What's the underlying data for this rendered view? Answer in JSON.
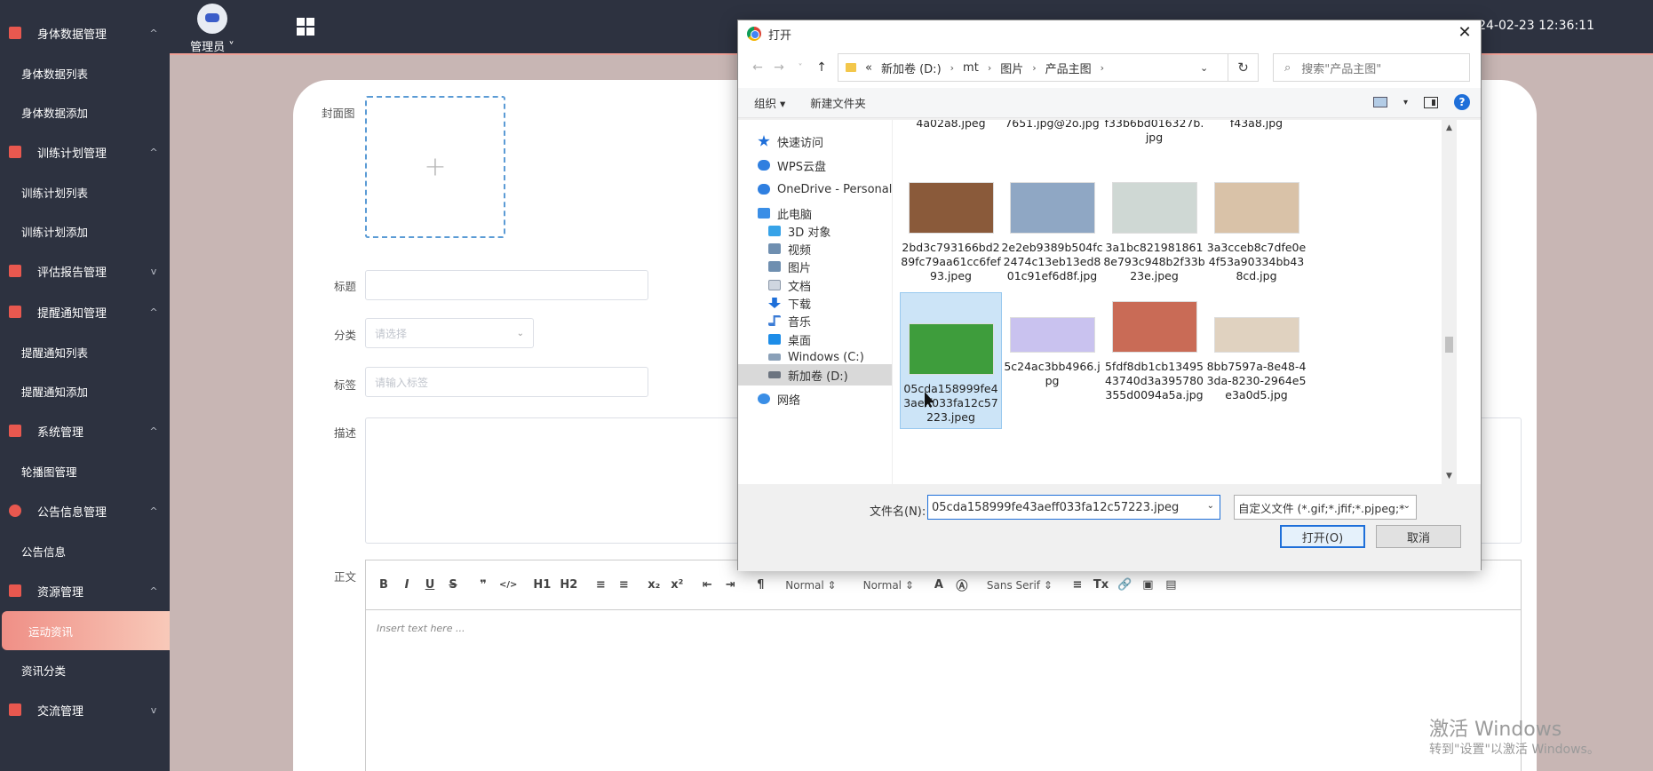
{
  "sidebar": {
    "groups": [
      {
        "label": "身体数据管理",
        "chevron": "^",
        "icon": "chart-icon",
        "items": [
          "身体数据列表",
          "身体数据添加"
        ]
      },
      {
        "label": "训练计划管理",
        "chevron": "^",
        "icon": "chart-icon",
        "items": [
          "训练计划列表",
          "训练计划添加"
        ]
      },
      {
        "label": "评估报告管理",
        "chevron": "v",
        "icon": "chart-icon",
        "items": []
      },
      {
        "label": "提醒通知管理",
        "chevron": "^",
        "icon": "chart-icon",
        "items": [
          "提醒通知列表",
          "提醒通知添加"
        ]
      },
      {
        "label": "系统管理",
        "chevron": "^",
        "icon": "bar-chart-icon",
        "items": [
          "轮播图管理"
        ]
      },
      {
        "label": "公告信息管理",
        "chevron": "^",
        "icon": "info-icon",
        "items": [
          "公告信息"
        ]
      },
      {
        "label": "资源管理",
        "chevron": "^",
        "icon": "flag-icon",
        "items": [
          "运动资讯",
          "资讯分类"
        ],
        "active_item": "运动资讯"
      },
      {
        "label": "交流管理",
        "chevron": "v",
        "icon": "send-icon",
        "items": []
      }
    ]
  },
  "topbar": {
    "user_label": "管理员 ˅",
    "clock": "24-02-23 12:36:11"
  },
  "form": {
    "cover_label": "封面图",
    "title_label": "标题",
    "category_label": "分类",
    "category_placeholder": "请选择",
    "tags_label": "标签",
    "tags_placeholder": "请输入标签",
    "desc_label": "描述",
    "body_label": "正文",
    "editor_placeholder": "Insert text here ...",
    "toolbar": {
      "bold": "B",
      "italic": "I",
      "underline": "U",
      "strike": "S",
      "quote": "❞",
      "code": "</>",
      "h1": "H1",
      "h2": "H2",
      "ol": "≡",
      "ul": "≡",
      "sub": "x₂",
      "sup": "x²",
      "outdent": "⇤",
      "indent": "⇥",
      "rtl": "¶",
      "size": "Normal ⇕",
      "header": "Normal ⇕",
      "font": "Sans Serif ⇕",
      "align": "≡",
      "clean": "Tx",
      "link": "🔗",
      "image": "▣",
      "video": "▤"
    }
  },
  "dialog": {
    "title": "打开",
    "close": "✕",
    "nav": {
      "back": "←",
      "forward": "→",
      "recent": "˅",
      "up": "↑"
    },
    "breadcrumb": [
      "«",
      "新加卷 (D:)",
      "mt",
      "图片",
      "产品主图"
    ],
    "refresh": "↻",
    "search_placeholder": "搜索\"产品主图\"",
    "organize": "组织 ▾",
    "new_folder": "新建文件夹",
    "help": "?",
    "nav_pane": [
      {
        "label": "快速访问",
        "icon": "star-icon",
        "sub": false
      },
      {
        "label": "WPS云盘",
        "icon": "cloud-icon",
        "sub": false
      },
      {
        "label": "OneDrive - Personal",
        "icon": "onedrive-icon",
        "sub": false
      },
      {
        "label": "此电脑",
        "icon": "computer-icon",
        "sub": false
      },
      {
        "label": "3D 对象",
        "icon": "cube-icon",
        "sub": true
      },
      {
        "label": "视频",
        "icon": "video-icon",
        "sub": true
      },
      {
        "label": "图片",
        "icon": "image-icon",
        "sub": true
      },
      {
        "label": "文档",
        "icon": "document-icon",
        "sub": true
      },
      {
        "label": "下载",
        "icon": "download-icon",
        "sub": true
      },
      {
        "label": "音乐",
        "icon": "music-icon",
        "sub": true
      },
      {
        "label": "桌面",
        "icon": "desktop-icon",
        "sub": true
      },
      {
        "label": "Windows (C:)",
        "icon": "drive-icon",
        "sub": true
      },
      {
        "label": "新加卷 (D:)",
        "icon": "drive-icon",
        "sub": true,
        "selected": true
      },
      {
        "label": "网络",
        "icon": "network-icon",
        "sub": false
      }
    ],
    "files": [
      {
        "name": "4a02a8.jpeg",
        "color": "",
        "thumb": false
      },
      {
        "name": "7651.jpg@2o.jpg",
        "color": "",
        "thumb": false
      },
      {
        "name": "f33b6bd016327b.jpg",
        "color": "",
        "thumb": false
      },
      {
        "name": "f43a8.jpg",
        "color": "",
        "thumb": false
      },
      {
        "name": "2bd3c793166bd289fc79aa61cc6fef93.jpeg",
        "color": "#8a5a3a",
        "thumb": true
      },
      {
        "name": "2e2eb9389b504fc2474c13eb13ed801c91ef6d8f.jpg",
        "color": "#8fa7c4",
        "thumb": true
      },
      {
        "name": "3a1bc8219818618e793c948b2f33b23e.jpeg",
        "color": "#cfd8d4",
        "thumb": true
      },
      {
        "name": "3a3cceb8c7dfe0e4f53a90334bb438cd.jpg",
        "color": "#d9c2a8",
        "thumb": true
      },
      {
        "name": "05cda158999fe43aeff033fa12c57223.jpeg",
        "color": "#3e9d3c",
        "thumb": true,
        "selected": true
      },
      {
        "name": "5c24ac3bb4966.jpg",
        "color": "#c9c2ef",
        "thumb": true
      },
      {
        "name": "5fdf8db1cb1349543740d3a395780355d0094a5a.jpg",
        "color": "#c96b56",
        "thumb": true
      },
      {
        "name": "8bb7597a-8e48-43da-8230-2964e5e3a0d5.jpg",
        "color": "#e0d2c0",
        "thumb": true
      }
    ],
    "filename_label": "文件名(N):",
    "filename_value": "05cda158999fe43aeff033fa12c57223.jpeg",
    "filetype": "自定义文件 (*.gif;*.jfif;*.pjpeg;*",
    "open_button": "打开(O)",
    "cancel_button": "取消"
  },
  "watermark": {
    "line1": "激活 Windows",
    "line2": "转到\"设置\"以激活 Windows。"
  }
}
